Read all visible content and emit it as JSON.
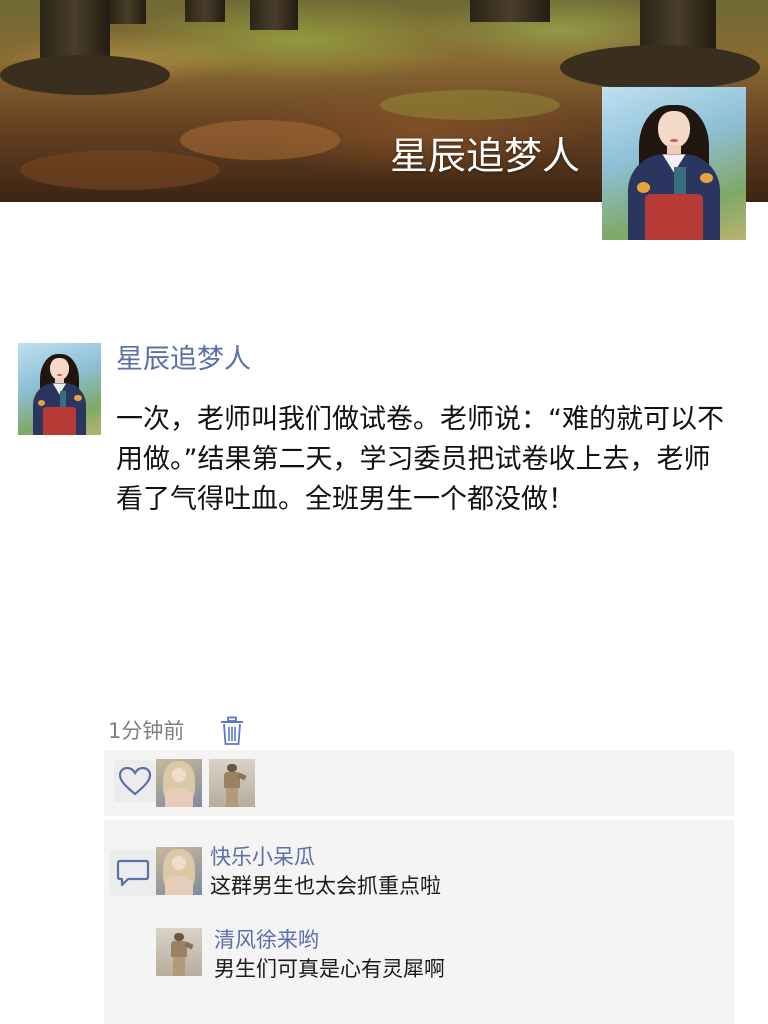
{
  "cover": {
    "username": "星辰追梦人",
    "avatar_icon": "woman-hanbok-avatar"
  },
  "post": {
    "author": "星辰追梦人",
    "avatar_icon": "woman-hanbok-avatar",
    "text": "一次，老师叫我们做试卷。老师说：“难的就可以不用做。”结果第二天，学习委员把试卷收上去，老师看了气得吐血。全班男生一个都没做！",
    "time": "1分钟前",
    "delete_icon": "trash-icon"
  },
  "likes": {
    "icon": "heart-icon",
    "users": [
      {
        "avatar": "blonde-woman-avatar"
      },
      {
        "avatar": "man-standing-avatar"
      }
    ]
  },
  "comments": {
    "icon": "comment-bubble-icon",
    "items": [
      {
        "name": "快乐小呆瓜",
        "text": "这群男生也太会抓重点啦",
        "avatar": "blonde-woman-avatar"
      },
      {
        "name": "清风徐来哟",
        "text": "男生们可真是心有灵犀啊",
        "avatar": "man-standing-avatar"
      }
    ]
  },
  "colors": {
    "link": "#5b6fa8",
    "panel": "#f4f4f4",
    "meta": "#7f7f7f"
  }
}
